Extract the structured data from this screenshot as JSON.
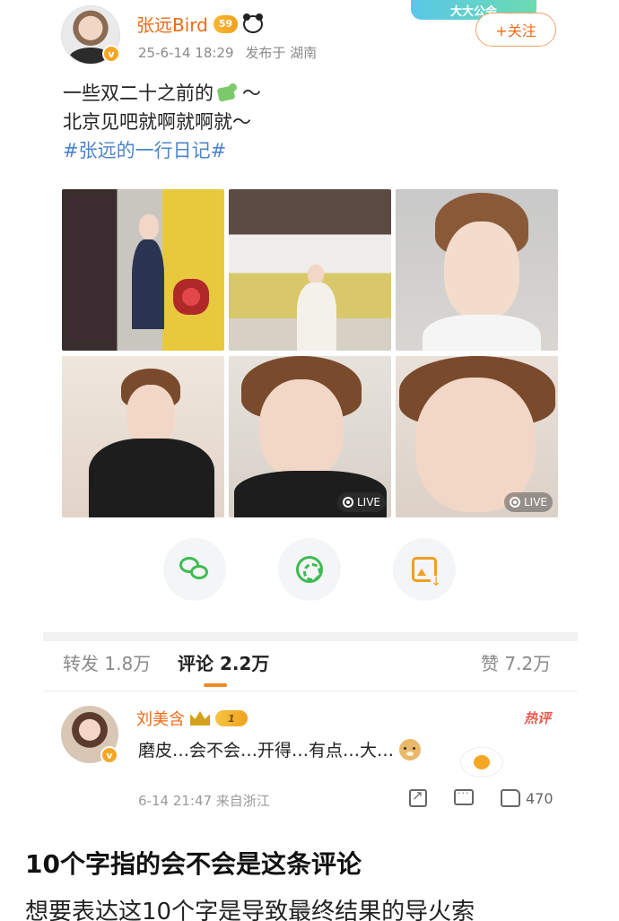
{
  "post": {
    "author": "张远Bird",
    "level": "59",
    "verified_mark": "v",
    "time": "25-6-14 18:29",
    "location": "发布于 湖南",
    "banner_text": "大大公会",
    "follow_label": "+关注",
    "text_line1_a": "一些双二十之前的",
    "text_line1_b": "～",
    "text_line2": "北京见吧就啊就啊就～",
    "hashtag": "#张远的一行日记#",
    "photos": [
      {
        "live": false
      },
      {
        "live": false
      },
      {
        "live": false
      },
      {
        "live": false
      },
      {
        "live": true,
        "label": "LIVE"
      },
      {
        "live": true,
        "label": "LIVE"
      }
    ],
    "live_label": "LIVE"
  },
  "share": {
    "items": [
      "wechat-icon",
      "moments-icon",
      "save-image-icon"
    ]
  },
  "tabs": {
    "repost": "转发 1.8万",
    "comment": "评论 2.2万",
    "like": "赞 7.2万"
  },
  "comment": {
    "author": "刘美含",
    "level": "1",
    "verified_mark": "v",
    "hot_label": "热评",
    "text": "磨皮…会不会…开得…有点…大…",
    "time_location": "6-14 21:47 来自浙江",
    "like_count": "470"
  },
  "article": {
    "heading": "10个字指的会不会是这条评论",
    "body": "想要表达这10个字是导致最终结果的导火索",
    "watermark": "@…"
  },
  "colors": {
    "accent": "#ef6a17",
    "link": "#4c84c8",
    "share_green": "#3dbb52",
    "hot_red": "#e85a4f"
  }
}
